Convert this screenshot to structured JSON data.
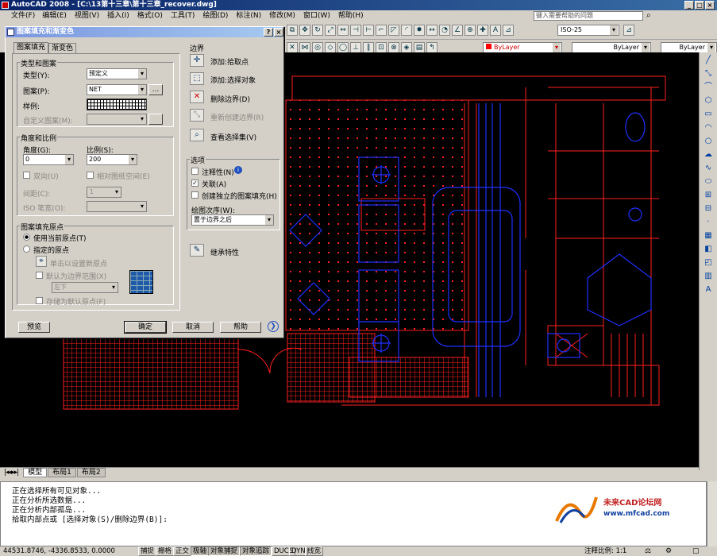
{
  "title": "AutoCAD 2008 - [C:\\13第十三章\\第十三章_recover.dwg]",
  "window_controls": [
    "_",
    "□",
    "×"
  ],
  "menu": [
    "文件(F)",
    "编辑(E)",
    "视图(V)",
    "插入(I)",
    "格式(O)",
    "工具(T)",
    "绘图(D)",
    "标注(N)",
    "修改(M)",
    "窗口(W)",
    "帮助(H)"
  ],
  "help_placeholder": "键入需要帮助的问题",
  "toolbar": {
    "dimstyle": "ISO-25",
    "color": "ByLayer",
    "linetype": "ByLayer",
    "lineweight": "ByLayer"
  },
  "dialog": {
    "title": "图案填充和渐变色",
    "tabs": [
      "图案填充",
      "渐变色"
    ],
    "type_group": "类型和图案",
    "type_label": "类型(Y):",
    "type_value": "预定义",
    "pattern_label": "图案(P):",
    "pattern_value": "NET",
    "sample_label": "样例:",
    "custom_label": "自定义图案(M):",
    "angle_group": "角度和比例",
    "angle_label": "角度(G):",
    "angle_value": "0",
    "scale_label": "比例(S):",
    "scale_value": "200",
    "double_label": "双向(U)",
    "relative_label": "相对图纸空间(E)",
    "spacing_label": "间距(C):",
    "spacing_value": "1",
    "iso_label": "ISO 笔宽(O):",
    "origin_group": "图案填充原点",
    "use_current": "使用当前原点(T)",
    "specify": "指定的原点",
    "click_set": "单击以设置新原点",
    "default_boundary": "默认为边界范围(X)",
    "position_value": "左下",
    "store_default": "存储为默认原点(F)",
    "boundary_group": "边界",
    "add_pick": "添加:拾取点",
    "add_select": "添加:选择对象",
    "remove": "删除边界(D)",
    "recreate": "重新创建边界(R)",
    "view_sel": "查看选择集(V)",
    "options_group": "选项",
    "annotative": "注释性(N)",
    "associative": "关联(A)",
    "independent": "创建独立的图案填充(H)",
    "draw_order_label": "绘图次序(W):",
    "draw_order_value": "置于边界之后",
    "inherit": "继承特性",
    "preview": "预览",
    "ok": "确定",
    "cancel": "取消",
    "help": "帮助"
  },
  "layout_tabs": [
    "模型",
    "布局1",
    "布局2"
  ],
  "command_lines": [
    "正在选择所有可见对象...",
    "正在分析所选数据...",
    "正在分析内部孤岛...",
    "拾取内部点或 [选择对象(S)/删除边界(B)]:"
  ],
  "logo": {
    "brand": "未来CAD论坛网",
    "url": "www.mfcad.com"
  },
  "status": {
    "coords": "44531.8746, -4336.8533, 0.0000",
    "buttons": [
      "捕捉",
      "栅格",
      "正交",
      "极轴",
      "对象捕捉",
      "对象追踪",
      "DUCS",
      "DYN",
      "线宽"
    ],
    "active": [
      "极轴",
      "对象捕捉",
      "对象追踪"
    ],
    "annotation_scale": "注释比例: 1:1"
  },
  "colors": {
    "titlebar": "#0a246a",
    "drawing_bg": "#000000",
    "red": "#ff2020",
    "blue": "#2030ff"
  }
}
